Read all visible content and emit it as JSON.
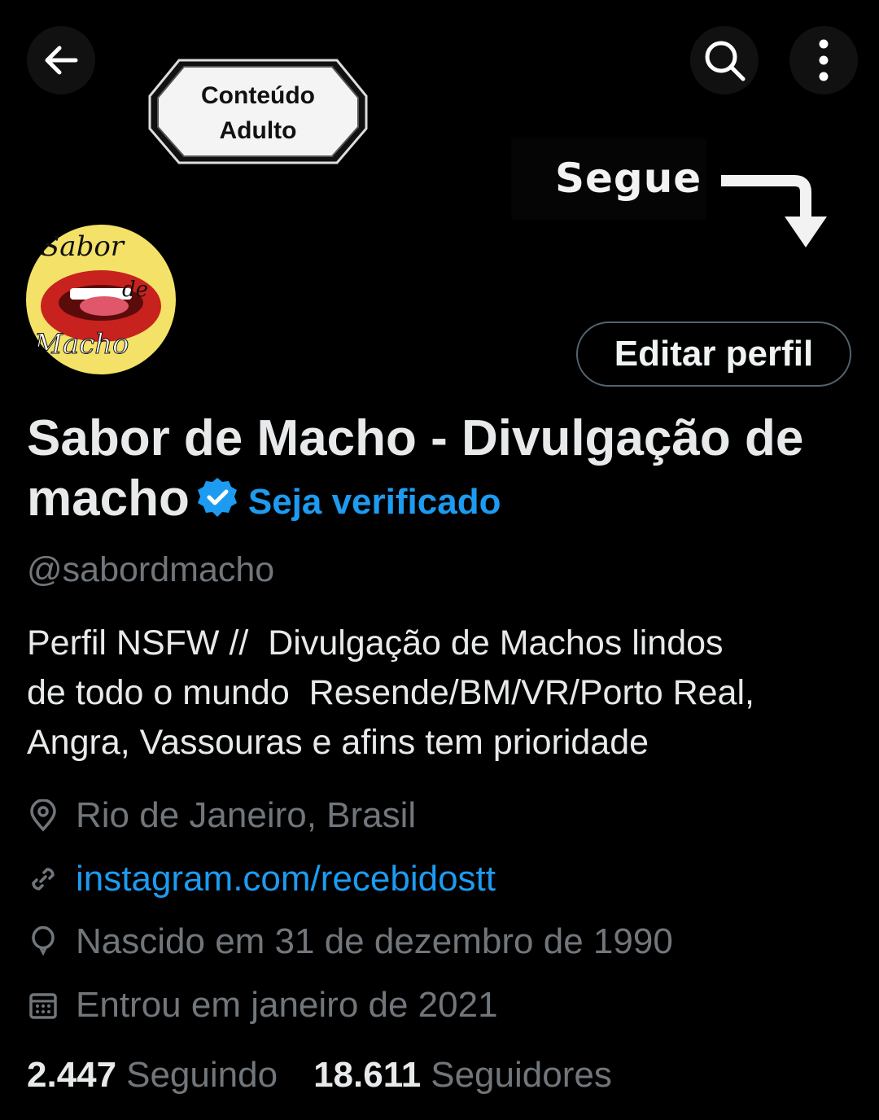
{
  "banner": {
    "adult_badge_line1": "Conteúdo",
    "adult_badge_line2": "Adulto",
    "follow_label": "Segue"
  },
  "header": {
    "back_icon": "arrow-left-icon",
    "search_icon": "search-icon",
    "more_icon": "more-vertical-icon"
  },
  "avatar": {
    "line1": "Sabor",
    "line2": "de",
    "line3": "Macho"
  },
  "profile": {
    "edit_button": "Editar perfil",
    "name": "Sabor de Macho - Divulgação de macho",
    "verify_cta": "Seja verificado",
    "handle": "@sabordmacho",
    "bio": "Perfil NSFW //  Divulgação de Machos lindos\nde todo o mundo  Resende/BM/VR/Porto Real,\nAngra, Vassouras e afins tem prioridade",
    "location": "Rio de Janeiro, Brasil",
    "website": "instagram.com/recebidostt",
    "birthday": "Nascido em 31 de dezembro de 1990",
    "joined": "Entrou em janeiro de 2021"
  },
  "stats": {
    "following_count": "2.447",
    "following_label": "Seguindo",
    "followers_count": "18.611",
    "followers_label": "Seguidores"
  },
  "colors": {
    "background": "#000000",
    "text": "#e7e9ea",
    "muted": "#71767b",
    "accent": "#1d9bf0"
  }
}
